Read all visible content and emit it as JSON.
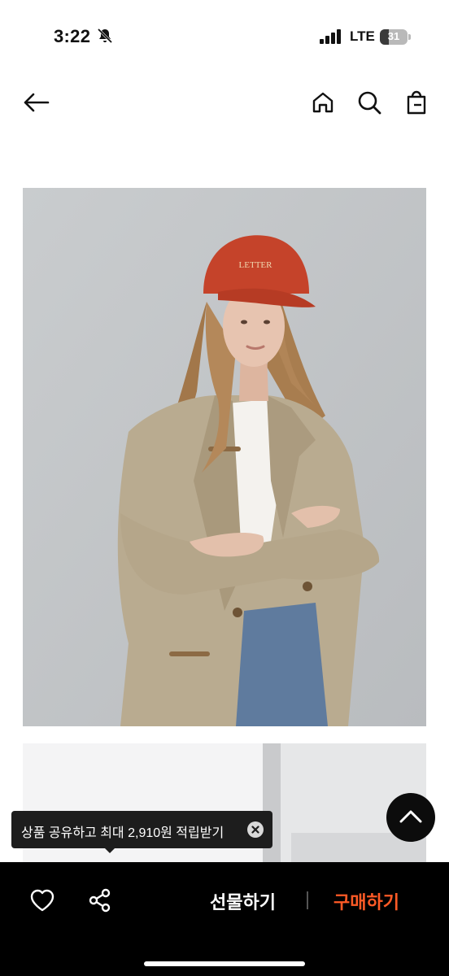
{
  "status_bar": {
    "time": "3:22",
    "network": "LTE",
    "battery": "31",
    "battery_level": 0.31,
    "icons": [
      "bell-slash-icon",
      "signal-icon",
      "battery-icon"
    ]
  },
  "nav": {
    "icons": [
      "back-arrow-icon",
      "home-icon",
      "search-icon",
      "shopping-bag-icon"
    ]
  },
  "product": {
    "images": [
      "product-photo-model",
      "product-photo-detail"
    ],
    "cap_text": "LETTER"
  },
  "tooltip": {
    "text": "상품 공유하고 최대 2,910원 적립받기"
  },
  "bottom_bar": {
    "gift_label": "선물하기",
    "buy_label": "구매하기",
    "icons": [
      "heart-icon",
      "share-icon",
      "scroll-top-icon"
    ]
  },
  "colors": {
    "buy_accent": "#ff5a26",
    "bar_background": "#000000"
  }
}
